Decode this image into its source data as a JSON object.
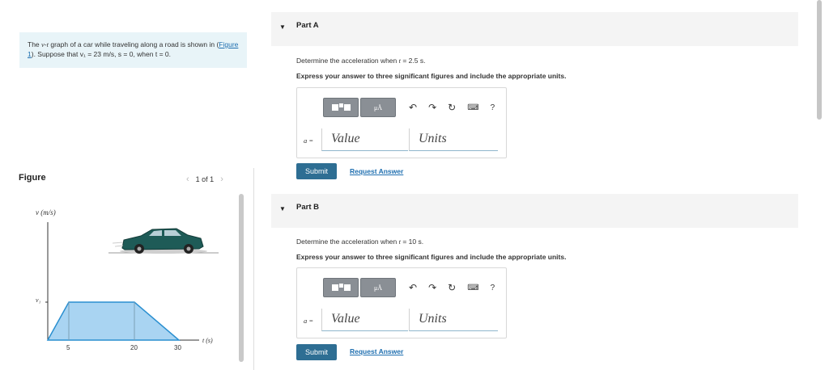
{
  "intro": {
    "prefix": "The ",
    "v": "v",
    "dash": "-",
    "t": "t",
    "mid": " graph of a car while traveling along a road is shown in (",
    "figure_link": "Figure 1",
    "suffix": "). Suppose that ",
    "cond": "v₁ = 23 m/s, s = 0, when t = 0."
  },
  "figure": {
    "title": "Figure",
    "pager": "1 of 1",
    "prev_icon": "chevron-left",
    "next_icon": "chevron-right",
    "y_axis_label": "v (m/s)",
    "x_axis_label": "t (s)",
    "v1_label": "v₁",
    "x_ticks": [
      "5",
      "20",
      "30"
    ]
  },
  "partA": {
    "title": "Part A",
    "question_prefix": "Determine the acceleration when ",
    "question_var": "t",
    "question_suffix": " = 2.5 s.",
    "instruction": "Express your answer to three significant figures and include the appropriate units.",
    "label": "a =",
    "value_placeholder": "Value",
    "units_placeholder": "Units",
    "submit": "Submit",
    "request": "Request Answer"
  },
  "partB": {
    "title": "Part B",
    "question_prefix": "Determine the acceleration when ",
    "question_var": "t",
    "question_suffix": " = 10 s.",
    "instruction": "Express your answer to three significant figures and include the appropriate units.",
    "label": "a =",
    "value_placeholder": "Value",
    "units_placeholder": "Units",
    "submit": "Submit",
    "request": "Request Answer"
  },
  "toolbar": {
    "help": "?",
    "icons": [
      "templates-icon",
      "units-icon",
      "undo-icon",
      "redo-icon",
      "reset-icon",
      "keyboard-icon",
      "help-icon"
    ]
  },
  "colors": {
    "accent": "#2e6e93",
    "link": "#1f6fb0",
    "graph_fill": "#a9d4f2",
    "graph_stroke": "#2a8fd0"
  }
}
